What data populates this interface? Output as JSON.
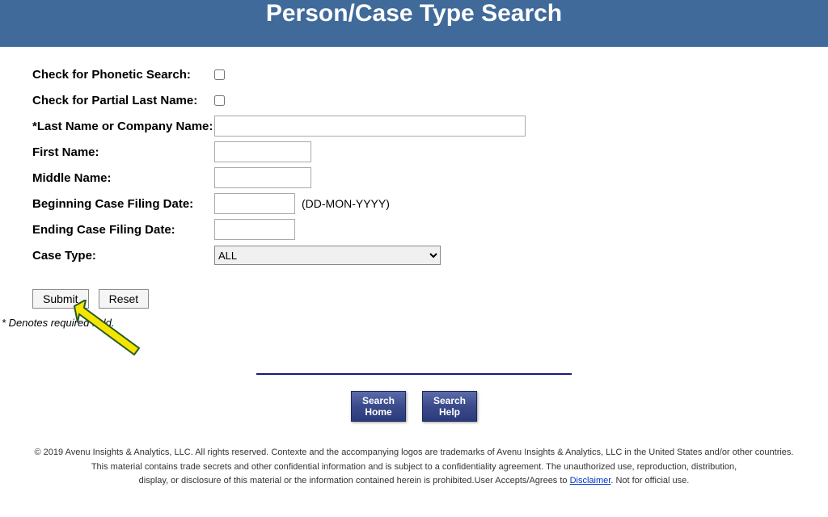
{
  "header": {
    "title": "Person/Case Type Search"
  },
  "form": {
    "phonetic_label": "Check for Phonetic Search:",
    "partial_label": "Check for Partial Last Name:",
    "lastname_label": "*Last Name or Company Name:",
    "firstname_label": "First Name:",
    "middlename_label": "Middle Name:",
    "begin_date_label": "Beginning Case Filing Date:",
    "end_date_label": "Ending Case Filing Date:",
    "date_hint": "(DD-MON-YYYY)",
    "casetype_label": "Case Type:",
    "casetype_selected": "ALL",
    "submit_label": "Submit",
    "reset_label": "Reset",
    "required_note": "* Denotes required field."
  },
  "nav": {
    "search_home_line1": "Search",
    "search_home_line2": "Home",
    "search_help_line1": "Search",
    "search_help_line2": "Help"
  },
  "footer": {
    "line1": "© 2019 Avenu Insights & Analytics, LLC. All rights reserved. Contexte and the accompanying logos are trademarks of Avenu Insights & Analytics, LLC in the United States and/or other countries.",
    "line2": "This material contains trade secrets and other confidential information and is subject to a confidentiality agreement. The unauthorized use, reproduction, distribution,",
    "line3a": "display, or disclosure of this material or the information contained herein is prohibited.User Accepts/Agrees to ",
    "disclaimer_link": "Disclaimer",
    "line3b": ". Not for official use."
  }
}
